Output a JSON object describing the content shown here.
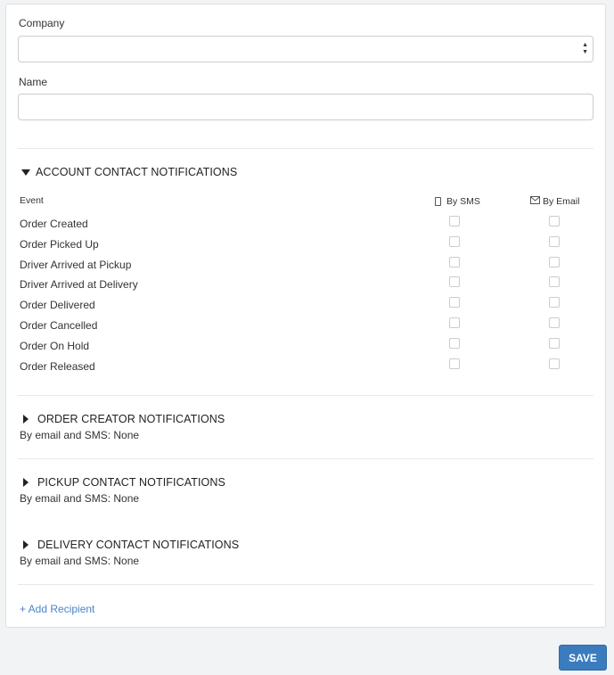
{
  "form": {
    "company_label": "Company",
    "company_value": "",
    "name_label": "Name",
    "name_value": "",
    "name_placeholder": ""
  },
  "account_section": {
    "title": "ACCOUNT CONTACT NOTIFICATIONS",
    "expanded": true,
    "event_header": "Event",
    "sms_header": "By SMS",
    "email_header": "By Email",
    "events": [
      {
        "label": "Order Created",
        "sms": false,
        "email": false
      },
      {
        "label": "Order Picked Up",
        "sms": false,
        "email": false
      },
      {
        "label": "Driver Arrived at Pickup",
        "sms": false,
        "email": false
      },
      {
        "label": "Driver Arrived at Delivery",
        "sms": false,
        "email": false
      },
      {
        "label": "Order Delivered",
        "sms": false,
        "email": false
      },
      {
        "label": "Order Cancelled",
        "sms": false,
        "email": false
      },
      {
        "label": "Order On Hold",
        "sms": false,
        "email": false
      },
      {
        "label": "Order Released",
        "sms": false,
        "email": false
      }
    ]
  },
  "collapsed_sections": [
    {
      "title": "ORDER CREATOR NOTIFICATIONS",
      "summary": "By email and SMS: None"
    },
    {
      "title": "PICKUP CONTACT NOTIFICATIONS",
      "summary": "By email and SMS: None"
    },
    {
      "title": "DELIVERY CONTACT NOTIFICATIONS",
      "summary": "By email and SMS: None"
    }
  ],
  "add_recipient_label": "+ Add Recipient",
  "save_label": "SAVE",
  "colors": {
    "accent": "#3a7cbd",
    "link": "#4a86c5",
    "background": "#f2f3f5"
  },
  "icons": {
    "sms": "phone-icon",
    "email": "envelope-icon",
    "expanded": "caret-down-icon",
    "collapsed": "caret-right-icon",
    "select": "select-arrows-icon"
  }
}
